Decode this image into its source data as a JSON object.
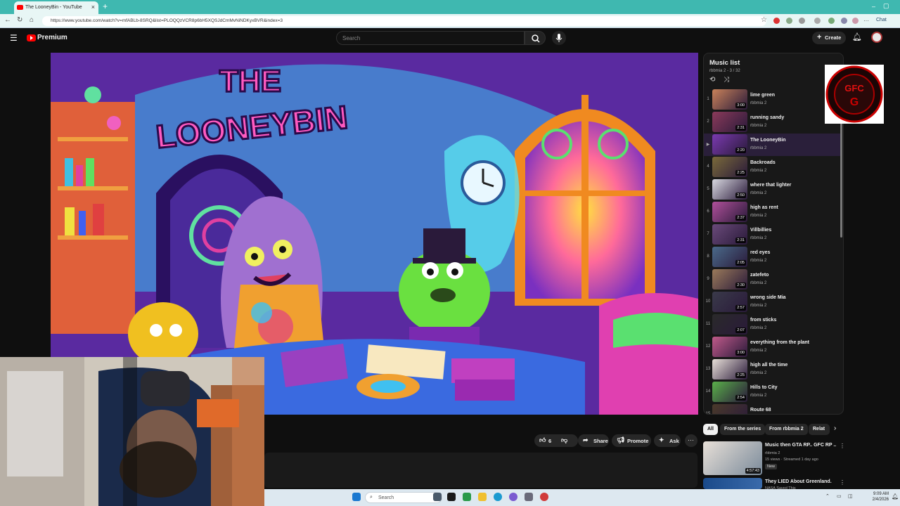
{
  "browser": {
    "tab_title": "The LooneyBin - YouTube",
    "url": "https://www.youtube.com/watch?v=mfABLb-8SRQ&list=PLOQQzVCR8p6bH5XQSJdCmMvNiNDKyxBVR&index=3",
    "chat_label": "Chat"
  },
  "header": {
    "logo_text": "Premium",
    "search_placeholder": "Search",
    "create_label": "Create"
  },
  "video": {
    "art_title": "THE LOONEYBIN"
  },
  "actions": {
    "likes": "6",
    "share": "Share",
    "promote": "Promote",
    "ask": "Ask"
  },
  "playlist": {
    "title": "Music list",
    "meta": "rbbmia 2 - 3 / 32",
    "items": [
      {
        "num": "1",
        "title": "lime green",
        "channel": "rbbmia 2",
        "duration": "3:00",
        "color": "#c9825a"
      },
      {
        "num": "2",
        "title": "running sandy",
        "channel": "rbbmia 2",
        "duration": "2:31",
        "color": "#8a3a5a"
      },
      {
        "num": "▶",
        "title": "The LooneyBin",
        "channel": "rbbmia 2",
        "duration": "2:20",
        "color": "#7a3ab0"
      },
      {
        "num": "4",
        "title": "Backroads",
        "channel": "rbbmia 2",
        "duration": "2:25",
        "color": "#7a6a3a"
      },
      {
        "num": "5",
        "title": "where that lighter",
        "channel": "rbbmia 2",
        "duration": "2:50",
        "color": "#d8d8e0"
      },
      {
        "num": "6",
        "title": "high as rent",
        "channel": "rbbmia 2",
        "duration": "2:37",
        "color": "#b0509a"
      },
      {
        "num": "7",
        "title": "Villbillies",
        "channel": "rbbmia 2",
        "duration": "2:31",
        "color": "#6a4a7a"
      },
      {
        "num": "8",
        "title": "red eyes",
        "channel": "rbbmia 2",
        "duration": "2:05",
        "color": "#4a6a8a"
      },
      {
        "num": "9",
        "title": "zatefeto",
        "channel": "rbbmia 2",
        "duration": "2:30",
        "color": "#9a7a5a"
      },
      {
        "num": "10",
        "title": "wrong side Mia",
        "channel": "rbbmia 2",
        "duration": "2:57",
        "color": "#3a3a4a"
      },
      {
        "num": "11",
        "title": "from sticks",
        "channel": "rbbmia 2",
        "duration": "2:07",
        "color": "#2a2a2a"
      },
      {
        "num": "12",
        "title": "everything from the plant",
        "channel": "rbbmia 2",
        "duration": "3:00",
        "color": "#c05a8a"
      },
      {
        "num": "13",
        "title": "high all the time",
        "channel": "rbbmia 2",
        "duration": "2:25",
        "color": "#e8e0d8"
      },
      {
        "num": "14",
        "title": "Hills to City",
        "channel": "rbbmia 2",
        "duration": "2:54",
        "color": "#5ab04a"
      },
      {
        "num": "15",
        "title": "Route 68",
        "channel": "rbbmia 2",
        "duration": "",
        "color": "#4a3a2a"
      }
    ]
  },
  "chips": [
    "All",
    "From the series",
    "From rbbmia 2",
    "Relat"
  ],
  "recommendations": [
    {
      "title": "Music then GTA RP..  GFC RP ..",
      "channel": "rbbmia 2",
      "meta": "15 views · Streamed 1 day ago",
      "badge": "New",
      "duration": "4:57:43"
    },
    {
      "title": "They LIED About Greenland.",
      "channel": "NASA Saved This",
      "meta": "",
      "badge": "",
      "duration": ""
    }
  ],
  "taskbar": {
    "search_placeholder": "Search",
    "time": "9:09 AM",
    "date": "2/4/2026"
  },
  "logo": {
    "text": "GFC"
  }
}
